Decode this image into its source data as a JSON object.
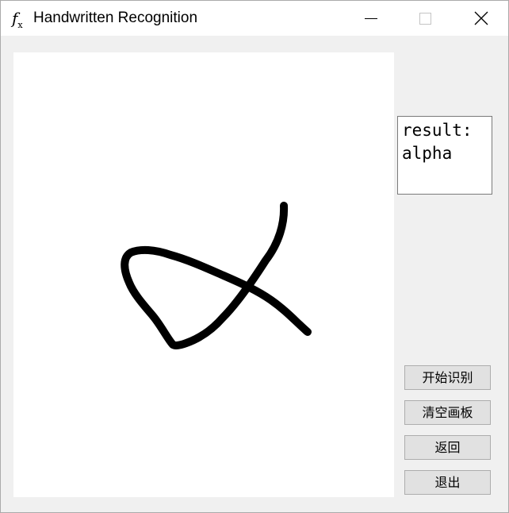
{
  "window": {
    "title": "Handwritten Recognition",
    "icon": "fx-function-icon",
    "icon_glyph": "f",
    "icon_sub": "x",
    "controls": [
      "minimize-icon",
      "maximize-icon",
      "close-icon"
    ]
  },
  "result": {
    "label": "result:",
    "value": "alpha"
  },
  "buttons": {
    "recognize": "开始识别",
    "clear": "清空画板",
    "back": "返回",
    "exit": "退出"
  },
  "colors": {
    "titlebar": "#ffffff",
    "window_bg": "#f0f0f0",
    "canvas_bg": "#ffffff",
    "stroke": "#000000",
    "button_bg": "#e1e1e1",
    "button_border": "#adadad"
  }
}
